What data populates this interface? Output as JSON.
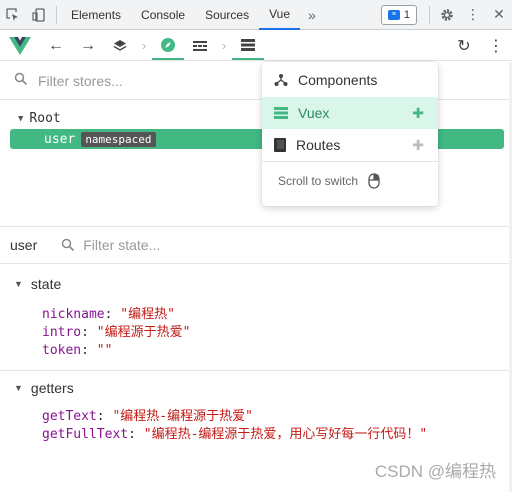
{
  "devtools": {
    "tabs": [
      "Elements",
      "Console",
      "Sources",
      "Vue"
    ],
    "active_tab": "Vue",
    "more": "»",
    "badge_count": "1"
  },
  "stores": {
    "filter_placeholder": "Filter stores..."
  },
  "tree": {
    "root_label": "Root",
    "user_label": "user",
    "namespaced_tag": "namespaced"
  },
  "state_panel": {
    "title": "user",
    "filter_placeholder": "Filter state...",
    "state_section": "state",
    "state_props": [
      {
        "key": "nickname",
        "value": "\"编程热\""
      },
      {
        "key": "intro",
        "value": "\"编程源于热爱\""
      },
      {
        "key": "token",
        "value": "\"\""
      }
    ],
    "getters_section": "getters",
    "getter_props": [
      {
        "key": "getText",
        "value": "\"编程热-编程源于热爱\""
      },
      {
        "key": "getFullText",
        "value": "\"编程热-编程源于热爱，用心写好每一行代码！\""
      }
    ]
  },
  "menu": {
    "items": [
      "Components",
      "Vuex",
      "Routes"
    ],
    "active": "Vuex",
    "footer": "Scroll to switch"
  },
  "watermark": "CSDN @编程热",
  "colors": {
    "vue_green": "#42b883",
    "active_bg": "#daf5ea",
    "string": "#c41a16",
    "key": "#881391"
  }
}
